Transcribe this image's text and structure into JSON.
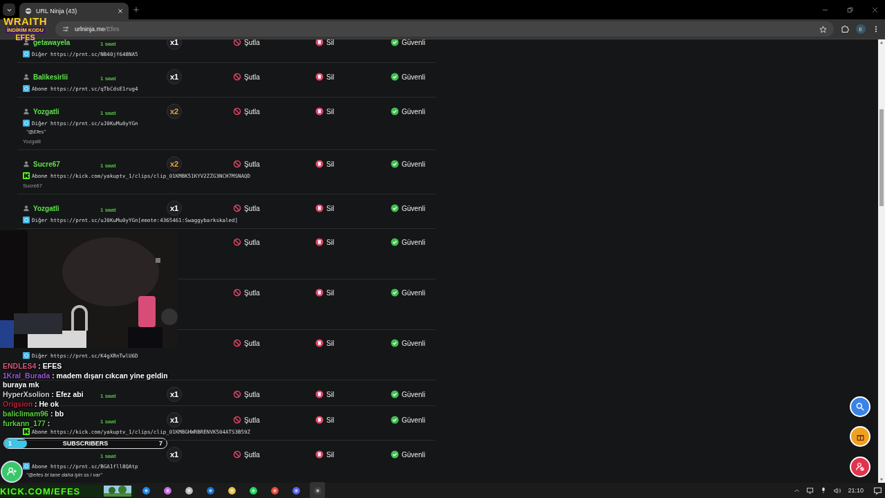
{
  "browser": {
    "tab": {
      "title": "URL Ninja (43)",
      "selected": true
    },
    "address": {
      "domain": "urlninja.me",
      "path": "/Efes"
    },
    "profile": "E"
  },
  "overlay_logo": {
    "line1": "WRAITH",
    "line2": "İNDİRİM KODU",
    "line3": "EFES"
  },
  "rows": [
    {
      "kind": "full",
      "user": "getawayela",
      "time": "1 saat",
      "count": {
        "text": "x1",
        "color": "#ffffff"
      },
      "link": {
        "kind": "prnt",
        "category": "Diğer",
        "url": "https://prnt.sc/NB40jf648NA5"
      },
      "actions": [
        "Şutla",
        "Sil",
        "Güvenli"
      ]
    },
    {
      "kind": "full",
      "user": "Balikesirlii",
      "time": "1 saat",
      "count": {
        "text": "x1",
        "color": "#ffffff"
      },
      "link": {
        "kind": "prnt",
        "category": "Abone",
        "url": "https://prnt.sc/qTbCdsE1rug4"
      },
      "actions": [
        "Şutla",
        "Sil",
        "Güvenli"
      ]
    },
    {
      "kind": "full",
      "user": "Yozgatli",
      "time": "1 saat",
      "count": {
        "text": "x2",
        "color": "#e8a23a"
      },
      "link": {
        "kind": "prnt",
        "category": "Diğer",
        "url": "https://prnt.sc/uJ0KuMu0yYGn"
      },
      "comment": "\"@Efes\"",
      "author": "Yozgatli",
      "actions": [
        "Şutla",
        "Sil",
        "Güvenli"
      ]
    },
    {
      "kind": "full",
      "user": "Sucre67",
      "time": "1 saat",
      "count": {
        "text": "x2",
        "color": "#e8a23a"
      },
      "link": {
        "kind": "kick",
        "category": "Abone",
        "url": "https://kick.com/yakuptv_1/clips/clip_01KM8K51KYV2ZZG3NCH7MSNAQD"
      },
      "author": "Sucre67",
      "actions": [
        "Şutla",
        "Sil",
        "Güvenli"
      ]
    },
    {
      "kind": "full",
      "user": "Yozgatli",
      "time": "1 saat",
      "count": {
        "text": "x1",
        "color": "#ffffff"
      },
      "link": {
        "kind": "prnt",
        "category": "Diğer",
        "url": "https://prnt.sc/uJ0KuMu0yYGn[emote:4365461:Swaggybarkskaled]"
      },
      "actions": [
        "Şutla",
        "Sil",
        "Güvenli"
      ]
    },
    {
      "kind": "covered",
      "actions": [
        "Şutla",
        "Sil",
        "Güvenli"
      ]
    },
    {
      "kind": "covered",
      "actions": [
        "Şutla",
        "Sil",
        "Güvenli"
      ]
    },
    {
      "kind": "covered",
      "link": {
        "kind": "prnt",
        "category": "Diğer",
        "url": "https://prnt.sc/K4gXRnTwlU6D"
      },
      "actions": [
        "Şutla",
        "Sil",
        "Güvenli"
      ]
    },
    {
      "kind": "full",
      "time": "1 saat",
      "count": {
        "text": "x1",
        "color": "#ffffff"
      },
      "actions": [
        "Şutla",
        "Sil",
        "Güvenli"
      ]
    },
    {
      "kind": "full",
      "time": "1 saat",
      "count": {
        "text": "x1",
        "color": "#ffffff"
      },
      "link": {
        "kind": "kick",
        "category": "Abone",
        "url": "https://kick.com/yakuptv_1/clips/clip_01KM8GHWRBRENVK504ATS3B59Z"
      },
      "actions": [
        "Şutla",
        "Sil",
        "Güvenli"
      ]
    },
    {
      "kind": "full",
      "time": "1 saat",
      "count": {
        "text": "x1",
        "color": "#ffffff"
      },
      "link": {
        "kind": "prnt",
        "category": "Abone",
        "url": "https://prnt.sc/BGA1fll8QAtp"
      },
      "comment": "\"@efes bi tane daha iyin ss i var\"",
      "actions": [
        "Şutla",
        "Sil",
        "Güvenli"
      ]
    }
  ],
  "chat": {
    "messages": [
      {
        "user": "ENDLES4",
        "color": "#d9587a",
        "text": ": EFES"
      },
      {
        "user": "1Kral_Burada",
        "color": "#9b59d9",
        "text": ": madem dışarı cıkcan yine geldin buraya mk"
      },
      {
        "user": "HyperXsolion",
        "color": "#d0d0d0",
        "text": ": Efez abi"
      },
      {
        "user": "Origsion",
        "color": "#c0203a",
        "text": ": He ok"
      },
      {
        "user": "baliclimam96",
        "color": "#58d23c",
        "text": ": bb"
      },
      {
        "user": "furkann_177",
        "color": "#58d23c",
        "text": ":"
      }
    ],
    "subscribers": {
      "current": "1",
      "label": "SUBSCRIBERS",
      "goal": "7",
      "level": 0.14
    }
  },
  "banner": "KICK.COM/EFES",
  "clock": "21:10"
}
